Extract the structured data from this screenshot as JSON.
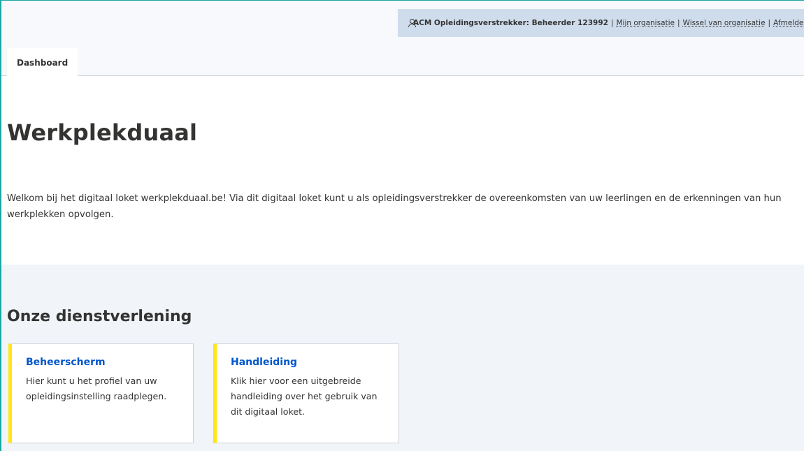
{
  "header": {
    "account_name": "ACM Opleidingsverstrekker: Beheerder 123992",
    "links": [
      "Mijn organisatie",
      "Wissel van organisatie",
      "Afmelden"
    ],
    "separator": "|"
  },
  "tabs": [
    {
      "label": "Dashboard",
      "active": true
    }
  ],
  "main": {
    "title": "Werkplekduaal",
    "intro": "Welkom bij het digitaal loket werkplekduaal.be! Via dit digitaal loket kunt u als opleidingsverstrekker de overeenkomsten van uw leerlingen en de erkenningen van hun werkplekken opvolgen."
  },
  "services": {
    "title": "Onze dienstverlening",
    "cards": [
      {
        "title": "Beheerscherm",
        "description": "Hier kunt u het profiel van uw opleidingsinstelling raadplegen."
      },
      {
        "title": "Handleiding",
        "description": "Klik hier voor een uitgebreide handleiding over het gebruik van dit digitaal loket."
      }
    ]
  },
  "colors": {
    "accent_link": "#0055cc",
    "card_accent": "#ffe615",
    "account_bar_bg": "#cfdcec",
    "section_bg": "#f1f4f8"
  }
}
